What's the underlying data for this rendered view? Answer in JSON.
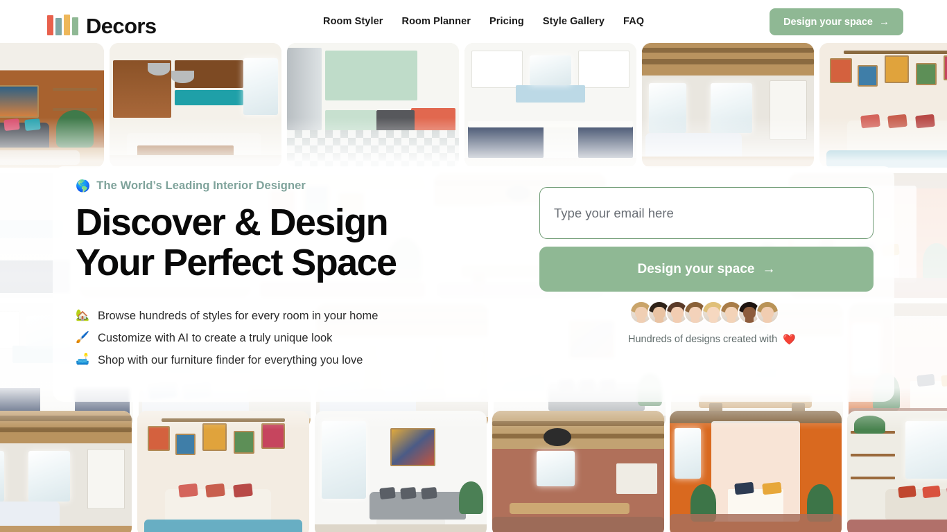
{
  "brand": {
    "name": "Decors",
    "logo_icon": "books-bars-logo",
    "bar_colors": [
      "#e8604c",
      "#7fa8a5",
      "#eeb75a",
      "#8fb894"
    ]
  },
  "theme": {
    "accent_green": "#8fb894",
    "accent_green_border": "#6f9b74",
    "eyebrow_teal": "#7fa39b",
    "headline_black": "#090909",
    "page_background": "#ffffff"
  },
  "nav": {
    "items": [
      {
        "label": "Room Styler"
      },
      {
        "label": "Room Planner"
      },
      {
        "label": "Pricing"
      },
      {
        "label": "Style Gallery"
      },
      {
        "label": "FAQ"
      }
    ]
  },
  "header": {
    "cta_label": "Design your space",
    "cta_arrow": "→"
  },
  "hero": {
    "eyebrow_icon": "🌎",
    "eyebrow": "The World’s Leading Interior Designer",
    "headline": "Discover & Design\nYour Perfect Space",
    "bullets": [
      {
        "icon": "🏡",
        "icon_name": "house-icon",
        "text": "Browse hundreds of styles for every room in your home"
      },
      {
        "icon": "🖌️",
        "icon_name": "paintbrush-icon",
        "text": "Customize with AI to create a truly unique look"
      },
      {
        "icon": "🛋️",
        "icon_name": "couch-icon",
        "text": "Shop with our furniture finder for everything you love"
      }
    ],
    "email": {
      "placeholder": "Type your email here",
      "value": ""
    },
    "cta_label": "Design your space",
    "cta_arrow": "→",
    "social_proof": {
      "text": "Hundreds of designs created with",
      "heart": "❤️",
      "avatar_count": 8,
      "avatars": [
        {
          "hair": "#c9a46a",
          "skin": "#f0cfb4"
        },
        {
          "hair": "#2e2219",
          "skin": "#e9c3a3"
        },
        {
          "hair": "#5a3a28",
          "skin": "#f2cdb2"
        },
        {
          "hair": "#8a6138",
          "skin": "#f3d2ba"
        },
        {
          "hair": "#e0c079",
          "skin": "#f6d8c0"
        },
        {
          "hair": "#a87c48",
          "skin": "#f3d3b8"
        },
        {
          "hair": "#1d1410",
          "skin": "#8d5c3c"
        },
        {
          "hair": "#b99357",
          "skin": "#f1cdb1"
        }
      ]
    }
  },
  "gallery": {
    "rows": [
      {
        "tiles": [
          {
            "name": "midcentury-living-room",
            "style": "midcentury-living"
          },
          {
            "name": "wood-kitchen-teal-backsplash",
            "style": "wood-kitchen"
          },
          {
            "name": "mint-green-kitchen",
            "style": "mint-kitchen"
          },
          {
            "name": "navy-white-kitchen",
            "style": "navy-kitchen"
          },
          {
            "name": "rustic-beam-bedroom",
            "style": "rustic-bedroom"
          },
          {
            "name": "boho-gallery-wall-bedroom",
            "style": "boho-bedroom"
          },
          {
            "name": "white-kitchen-gold",
            "style": "white-kitchen"
          }
        ]
      },
      {
        "tiles": [
          {
            "name": "blue-kitchen-shelves",
            "style": "blue-kitchen"
          },
          {
            "name": "neutral-bedroom-window",
            "style": "neutral-bedroom"
          },
          {
            "name": "eclectic-living-room",
            "style": "eclectic-living"
          },
          {
            "name": "bright-dining-room",
            "style": "bright-dining"
          },
          {
            "name": "modern-grey-sofa-room",
            "style": "modern-grey"
          },
          {
            "name": "canopy-bed-bedroom",
            "style": "canopy-bedroom"
          },
          {
            "name": "plant-filled-living-room",
            "style": "plant-living"
          }
        ]
      },
      {
        "tiles": [
          {
            "name": "navy-kitchen-herringbone",
            "style": "navy-kitchen"
          },
          {
            "name": "neutral-bedroom-linen",
            "style": "neutral-bedroom"
          },
          {
            "name": "farmhouse-bedroom",
            "style": "rustic-bedroom"
          },
          {
            "name": "sunlit-living-room",
            "style": "modern-grey"
          },
          {
            "name": "airy-dining-nook",
            "style": "bright-dining"
          },
          {
            "name": "warm-bedroom-curtains",
            "style": "canopy-bedroom"
          },
          {
            "name": "boho-plant-corner",
            "style": "plant-living"
          }
        ]
      },
      {
        "tiles": [
          {
            "name": "rustic-hallway-bedroom",
            "style": "rustic-bedroom"
          },
          {
            "name": "string-light-canopy-bedroom",
            "style": "boho-bedroom"
          },
          {
            "name": "minimal-grey-sectional-room",
            "style": "modern-grey"
          },
          {
            "name": "brick-farmhouse-dining",
            "style": "brick-dining"
          },
          {
            "name": "terracotta-canopy-bedroom",
            "style": "terracotta-bedroom"
          },
          {
            "name": "boho-sofa-plants-room",
            "style": "plant-living"
          }
        ]
      }
    ]
  }
}
